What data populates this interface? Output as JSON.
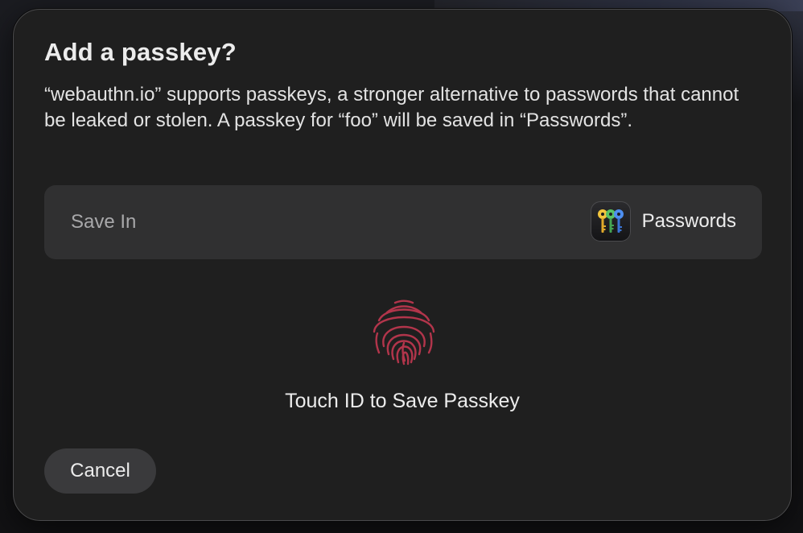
{
  "dialog": {
    "title": "Add a passkey?",
    "description": "“webauthn.io” supports passkeys, a stronger alternative to passwords that cannot be leaked or stolen. A passkey for “foo” will be saved in “Passwords”.",
    "save_in": {
      "label": "Save In",
      "app_name": "Passwords",
      "app_icon": "passwords-keys-icon"
    },
    "touch_id": {
      "icon": "fingerprint-icon",
      "label": "Touch ID to Save Passkey",
      "color": "#b2354b"
    },
    "cancel_label": "Cancel"
  },
  "colors": {
    "dialog_background": "#1f1f1f",
    "row_background": "#303031",
    "button_background": "#3a3a3c",
    "text_primary": "#ececec",
    "text_secondary": "#a8a8aa",
    "fingerprint": "#b2354b"
  }
}
